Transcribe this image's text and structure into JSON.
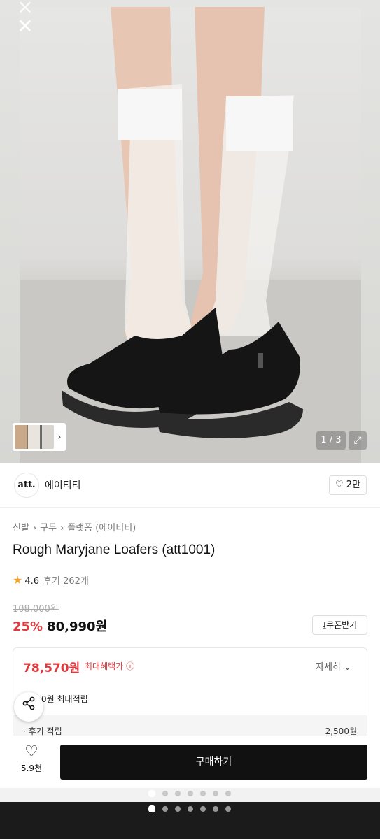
{
  "hero": {
    "close_icon": "close-icon",
    "page_counter": "1 / 3",
    "expand_icon": "expand-icon"
  },
  "brand": {
    "logo_text": "att.",
    "name": "에이티티",
    "like_count": "2만"
  },
  "breadcrumb": [
    "신발",
    "구두",
    "플랫폼 (에이티티)"
  ],
  "product": {
    "title": "Rough Maryjane Loafers (att1001)",
    "rating": "4.6",
    "reviews": "후기 262개",
    "original_price": "108,000원",
    "discount": "25%",
    "price": "80,990원",
    "coupon_label": "쿠폰받기"
  },
  "benefit": {
    "max_price": "78,570원",
    "max_label": "최대혜택가",
    "detail_label": "자세히",
    "points_label": "0원 최대적립",
    "review_points_label": "· 후기 적립",
    "review_points_value": "2,500원"
  },
  "bottom": {
    "wish_count": "5.9천",
    "buy_label": "구매하기"
  },
  "colors": {
    "accent_red": "#e0393e",
    "buy_button": "#111111",
    "star": "#f1a32b"
  }
}
